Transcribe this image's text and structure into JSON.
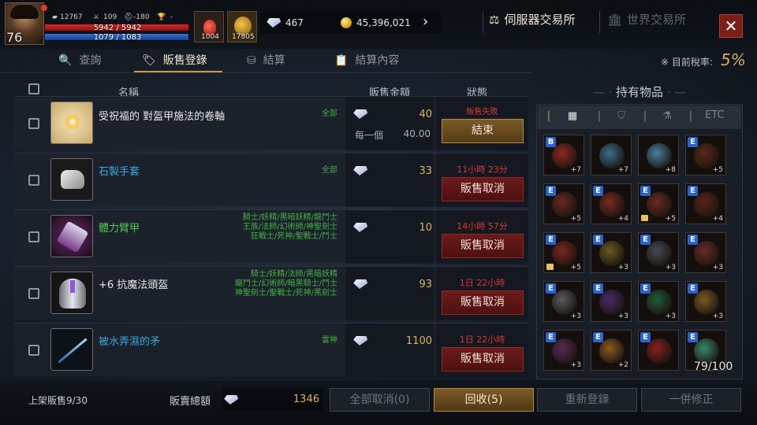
{
  "player": {
    "level": "76",
    "stat1": "12767",
    "stat2": "109",
    "stat3": "-180",
    "stat4": "-",
    "hp": "5942 / 5942",
    "mp": "1079 / 1083"
  },
  "slots": [
    {
      "count": "1004"
    },
    {
      "count": "17805"
    }
  ],
  "currency": {
    "diamonds": "467",
    "gold": "45,396,021"
  },
  "exchange_tabs": {
    "server": "伺服器交易所",
    "world": "世界交易所"
  },
  "close_label": "✕",
  "tabs": {
    "search": "查詢",
    "sales": "販售登錄",
    "settle": "結算",
    "settle_detail": "結算內容"
  },
  "tax": {
    "label": "目前稅率:",
    "value": "5%"
  },
  "columns": {
    "name": "名稱",
    "price": "販售金額",
    "status": "狀態"
  },
  "rows": [
    {
      "name": "受祝福的 對盔甲施法的卷軸",
      "name_color": "#e6e6e6",
      "class": "全部",
      "price": "40",
      "per_label": "每一個",
      "per_price": "40.00",
      "status": "販售失敗",
      "button": "結束",
      "button_style": "gold"
    },
    {
      "name": "石製手套",
      "name_color": "#3fa7e0",
      "class": "全部",
      "price": "33",
      "status": "11小時 23分",
      "button": "販售取消"
    },
    {
      "name": "體力臂甲",
      "name_color": "#4ec94e",
      "class_lines": [
        "騎士/妖精/黑暗妖精/龍鬥士",
        "王族/法師/幻術師/神聖劍士",
        "狂戰士/死神/聖戰士/鬥士"
      ],
      "price": "10",
      "status": "14小時 57分",
      "button": "販售取消"
    },
    {
      "name": "+6 抗魔法頭盔",
      "name_color": "#e6e6e6",
      "class_lines": [
        "騎士/妖精/法師/黑暗妖精",
        "龍鬥士/幻術師/暗黑騎士/鬥士",
        "神聖劍士/聖戰士/死神/黑劍士"
      ],
      "price": "93",
      "status": "1日 22小時",
      "button": "販售取消"
    },
    {
      "name": "被水弄濕的矛",
      "name_color": "#3fa7e0",
      "class": "雷神",
      "price": "1100",
      "status": "1日 22小時",
      "button": "販售取消"
    }
  ],
  "inventory": {
    "title": "持有物品",
    "etc_label": "ETC",
    "capacity": "79/100",
    "items": [
      {
        "badge": "B",
        "plus": "+7",
        "color": "#8e2a1e"
      },
      {
        "badge": "",
        "plus": "+7",
        "color": "#3b6f8c"
      },
      {
        "badge": "",
        "plus": "+8",
        "color": "#4a7fa0"
      },
      {
        "badge": "E",
        "plus": "+5",
        "color": "#5a2a1c"
      },
      {
        "badge": "E",
        "plus": "+5",
        "color": "#6b2a22"
      },
      {
        "badge": "E",
        "plus": "+4",
        "color": "#7a2a1e"
      },
      {
        "badge": "E",
        "plus": "+5",
        "color": "#6a2c20",
        "lock": true
      },
      {
        "badge": "E",
        "plus": "+4",
        "color": "#5c2418"
      },
      {
        "badge": "E",
        "plus": "+5",
        "color": "#7d2620",
        "lock": true
      },
      {
        "badge": "E",
        "plus": "+3",
        "color": "#6a5a22"
      },
      {
        "badge": "E",
        "plus": "+3",
        "color": "#454a55"
      },
      {
        "badge": "E",
        "plus": "+3",
        "color": "#6b2a2a"
      },
      {
        "badge": "E",
        "plus": "+3",
        "color": "#5a5a60"
      },
      {
        "badge": "E",
        "plus": "+3",
        "color": "#4d2a6a"
      },
      {
        "badge": "E",
        "plus": "+3",
        "color": "#1f5c3a"
      },
      {
        "badge": "E",
        "plus": "+3",
        "color": "#7a5a22"
      },
      {
        "badge": "E",
        "plus": "+3",
        "color": "#5a2a55"
      },
      {
        "badge": "E",
        "plus": "+2",
        "color": "#8a5a1e"
      },
      {
        "badge": "E",
        "plus": "",
        "color": "#8a1e1e"
      },
      {
        "badge": "E",
        "plus": "",
        "color": "#3a8a6a"
      }
    ]
  },
  "footer": {
    "on_sale": "上架販售9/30",
    "total_label": "販賣總額",
    "total_value": "1346",
    "cancel_all": "全部取消(0)",
    "recover": "回收(5)",
    "relist": "重新登錄",
    "fix_all": "一併修正"
  }
}
